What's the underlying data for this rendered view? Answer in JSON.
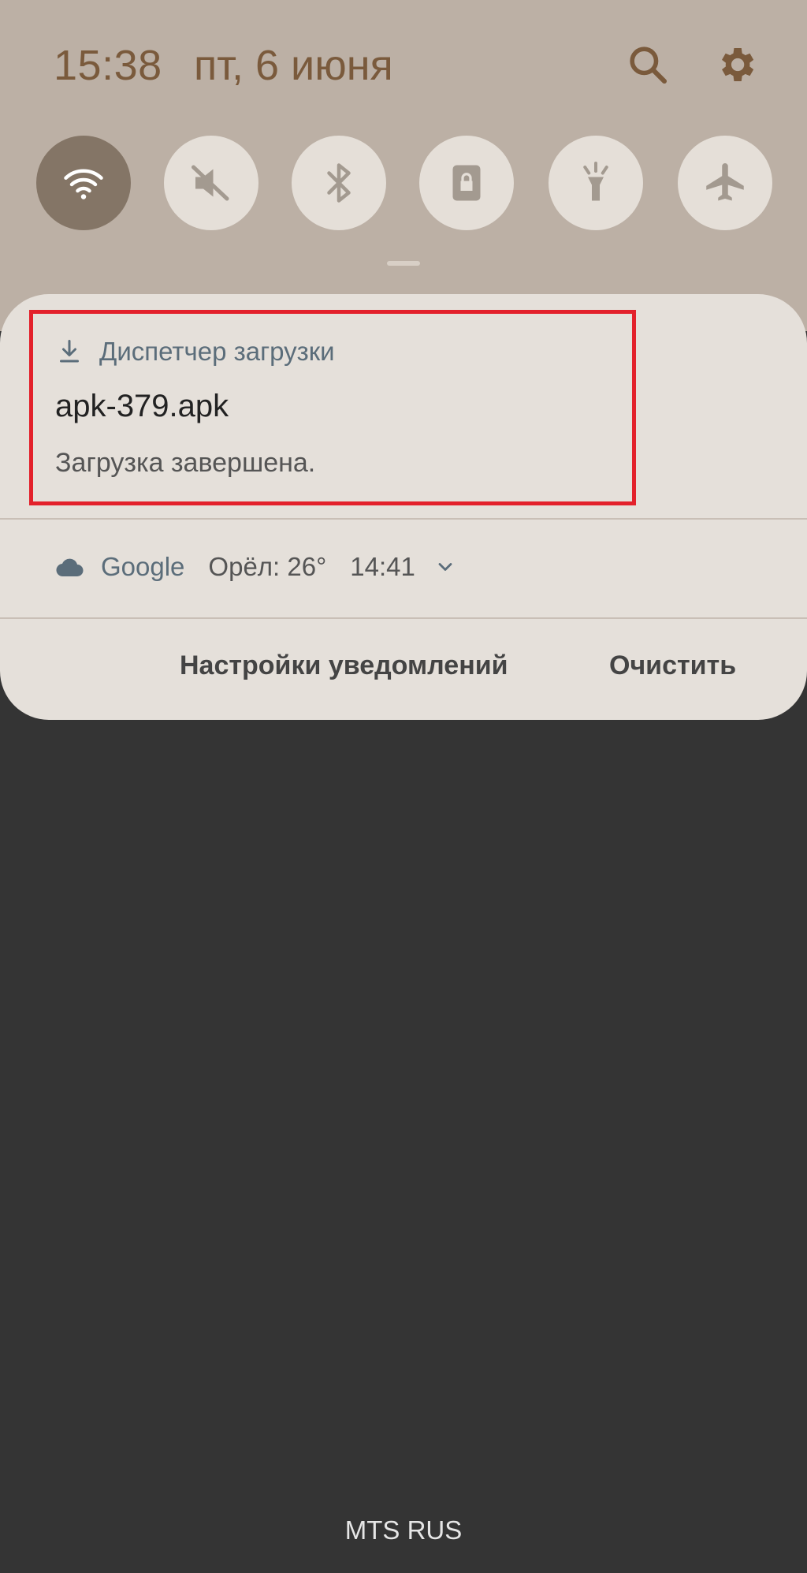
{
  "status": {
    "time": "15:38",
    "date": "пт, 6 июня"
  },
  "quick_settings": [
    {
      "name": "wifi",
      "icon": "wifi-icon",
      "active": true
    },
    {
      "name": "sound",
      "icon": "mute-icon",
      "active": false
    },
    {
      "name": "bluetooth",
      "icon": "bluetooth-icon",
      "active": false
    },
    {
      "name": "rotation-lock",
      "icon": "lock-icon",
      "active": false
    },
    {
      "name": "flashlight",
      "icon": "flashlight-icon",
      "active": false
    },
    {
      "name": "airplane",
      "icon": "airplane-icon",
      "active": false
    }
  ],
  "notification": {
    "app_name": "Диспетчер загрузки",
    "title": "apk-379.apk",
    "text": "Загрузка завершена."
  },
  "weather": {
    "app_name": "Google",
    "temp": "Орёл: 26°",
    "time": "14:41"
  },
  "actions": {
    "settings_label": "Настройки уведомлений",
    "clear_label": "Очистить"
  },
  "carrier": "MTS RUS",
  "colors": {
    "highlight": "#e3212b",
    "shade": "#bcb0a5",
    "panel": "#e5e0da",
    "background": "#343434"
  }
}
